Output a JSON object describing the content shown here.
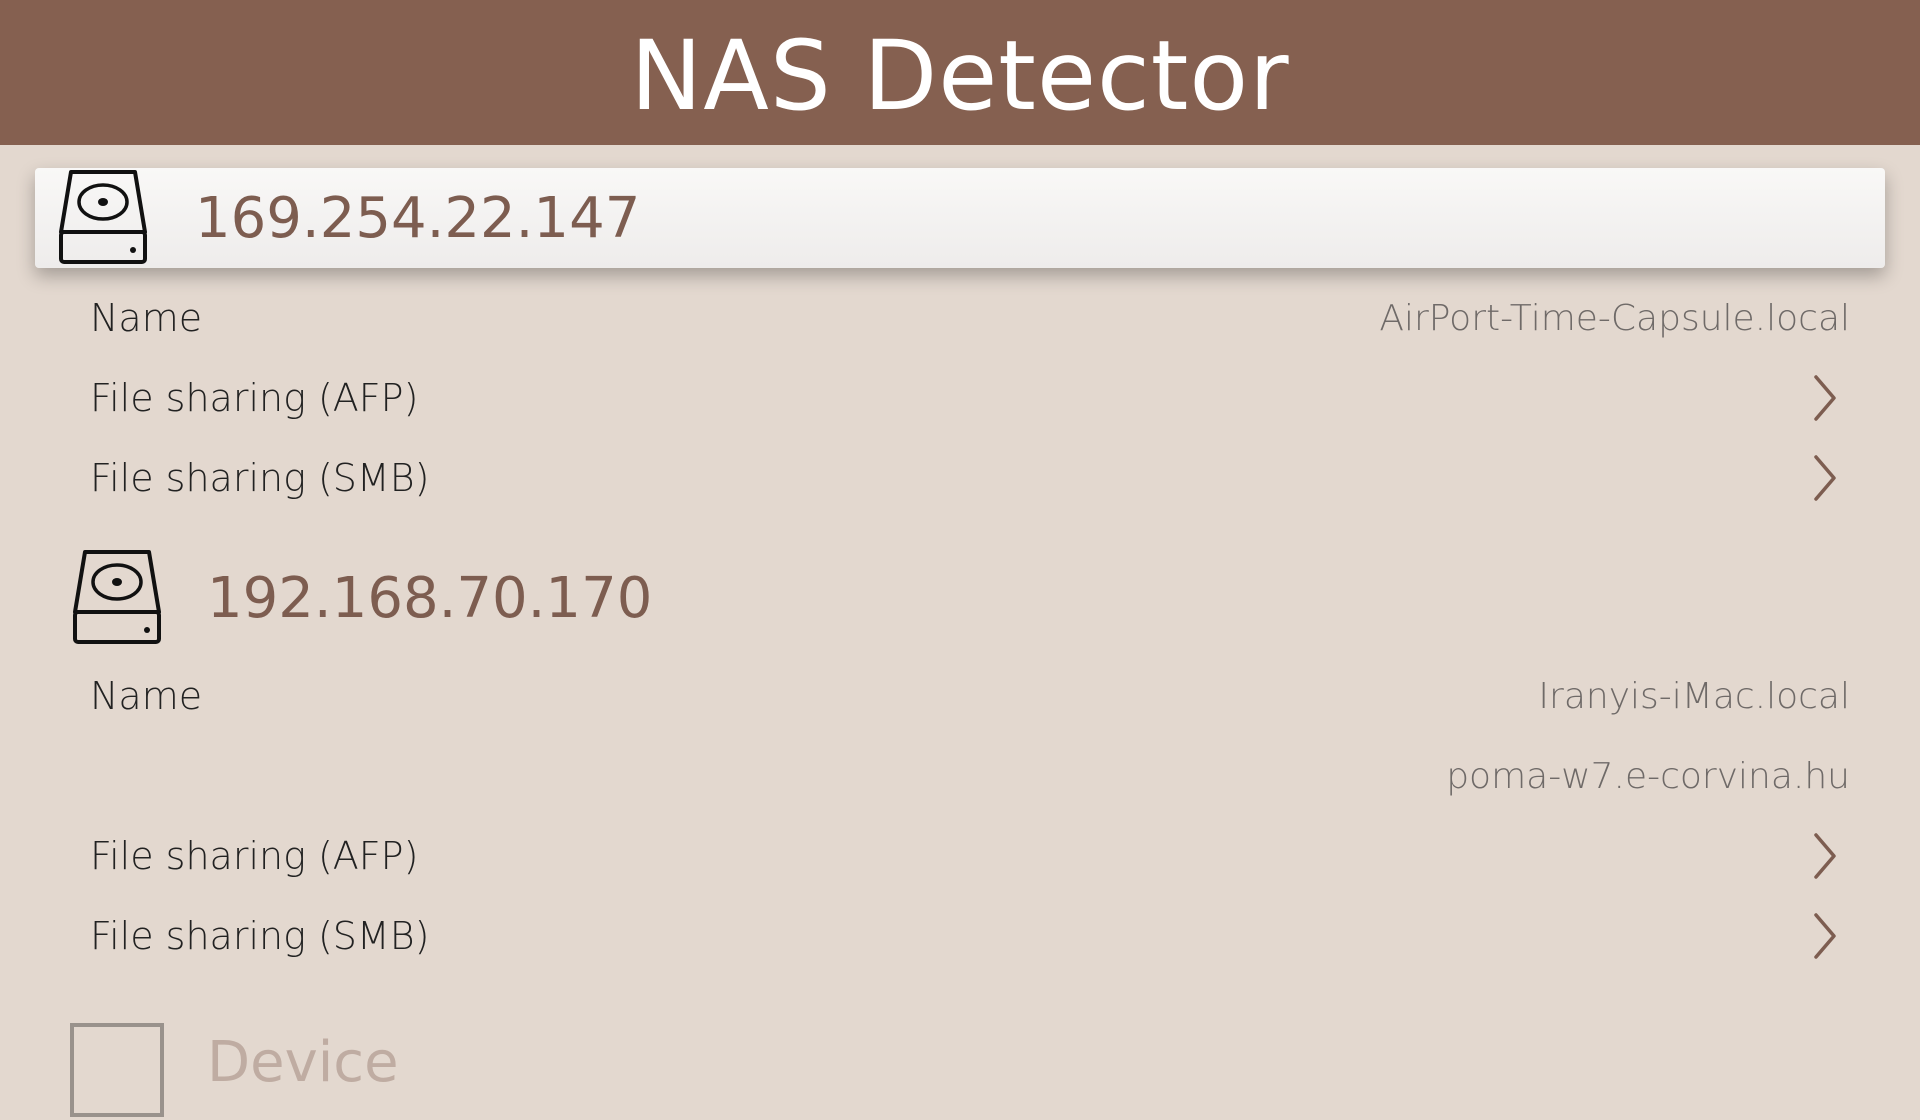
{
  "app": {
    "title": "NAS Detector"
  },
  "colors": {
    "header_bg": "#856050",
    "page_bg": "#e3d8cf",
    "accent_text": "#7d5d50"
  },
  "devices": [
    {
      "ip": "169.254.22.147",
      "icon": "hard-drive-icon",
      "selected": true,
      "name_label": "Name",
      "names": [
        "AirPort-Time-Capsule.local"
      ],
      "services": [
        {
          "label": "File sharing (AFP)",
          "icon": "chevron-right-icon"
        },
        {
          "label": "File sharing (SMB)",
          "icon": "chevron-right-icon"
        }
      ]
    },
    {
      "ip": "192.168.70.170",
      "icon": "hard-drive-icon",
      "selected": false,
      "name_label": "Name",
      "names": [
        "Iranyis-iMac.local",
        "poma-w7.e-corvina.hu"
      ],
      "services": [
        {
          "label": "File sharing (AFP)",
          "icon": "chevron-right-icon"
        },
        {
          "label": "File sharing (SMB)",
          "icon": "chevron-right-icon"
        }
      ]
    },
    {
      "ip": "Device",
      "icon": "device-placeholder-icon",
      "selected": false
    }
  ]
}
